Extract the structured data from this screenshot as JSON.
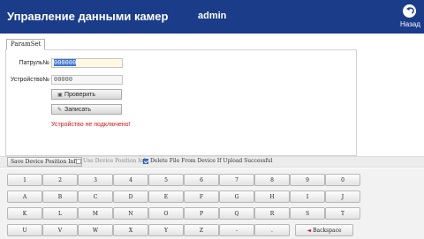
{
  "header": {
    "title": "Управление данными камер",
    "user": "admin",
    "back_label": "Назад"
  },
  "tabs": [
    {
      "label": "ParamSet",
      "active": true
    }
  ],
  "form": {
    "patrol_label": "Патруль№",
    "patrol_value": "000000",
    "device_label": "Устройство№",
    "device_value": "00000",
    "check_button": "Проверить",
    "write_button": "Записать",
    "status_message": "Устройство не подключено!"
  },
  "options": {
    "save_position_button": "Save Device Position Info",
    "use_position_label": "Use Device Position Info",
    "use_position_checked": false,
    "delete_file_label": "Delete File From Device If Upload Successful",
    "delete_file_checked": true
  },
  "keyboard": {
    "row1": [
      "1",
      "2",
      "3",
      "4",
      "5",
      "6",
      "7",
      "8",
      "9",
      "0"
    ],
    "row2": [
      "A",
      "B",
      "C",
      "D",
      "E",
      "F",
      "G",
      "H",
      "I",
      "J"
    ],
    "row3": [
      "K",
      "L",
      "M",
      "N",
      "O",
      "P",
      "Q",
      "R",
      "S",
      "T"
    ],
    "row4": [
      "U",
      "V",
      "W",
      "X",
      "Y",
      "Z",
      "-",
      "."
    ],
    "backspace_label": "Backspace"
  },
  "colors": {
    "header_bg": "#1b3c88",
    "status_error": "#dd1111",
    "selection": "#3b74d6"
  }
}
